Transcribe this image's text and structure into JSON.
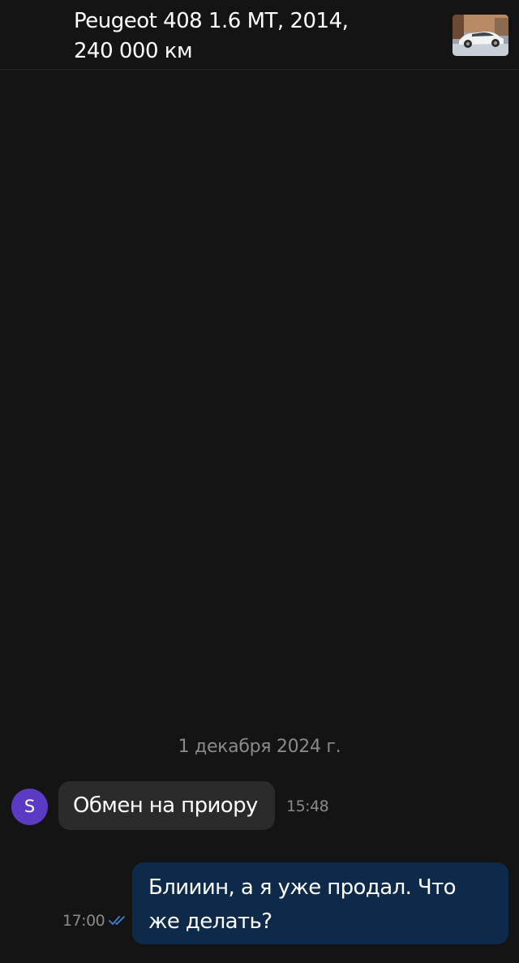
{
  "header": {
    "title_line1": "Peugeot 408 1.6 MT, 2014,",
    "title_line2": "240 000 км",
    "thumbnail_icon": "car-photo-thumbnail"
  },
  "chat": {
    "date_divider": "1 декабря 2024 г.",
    "messages": [
      {
        "direction": "incoming",
        "avatar_letter": "S",
        "avatar_color": "#5b3bc4",
        "text": "Обмен на приору",
        "time": "15:48"
      },
      {
        "direction": "outgoing",
        "text": "Блииин, а я уже продал. Что же делать?",
        "time": "17:00",
        "status_icon": "double-check-icon"
      }
    ]
  },
  "colors": {
    "background": "#141414",
    "incoming_bubble": "#2b2b2b",
    "outgoing_bubble": "#0e2a4a",
    "read_check": "#3f7fd4",
    "muted_text": "#8a8a8a"
  }
}
